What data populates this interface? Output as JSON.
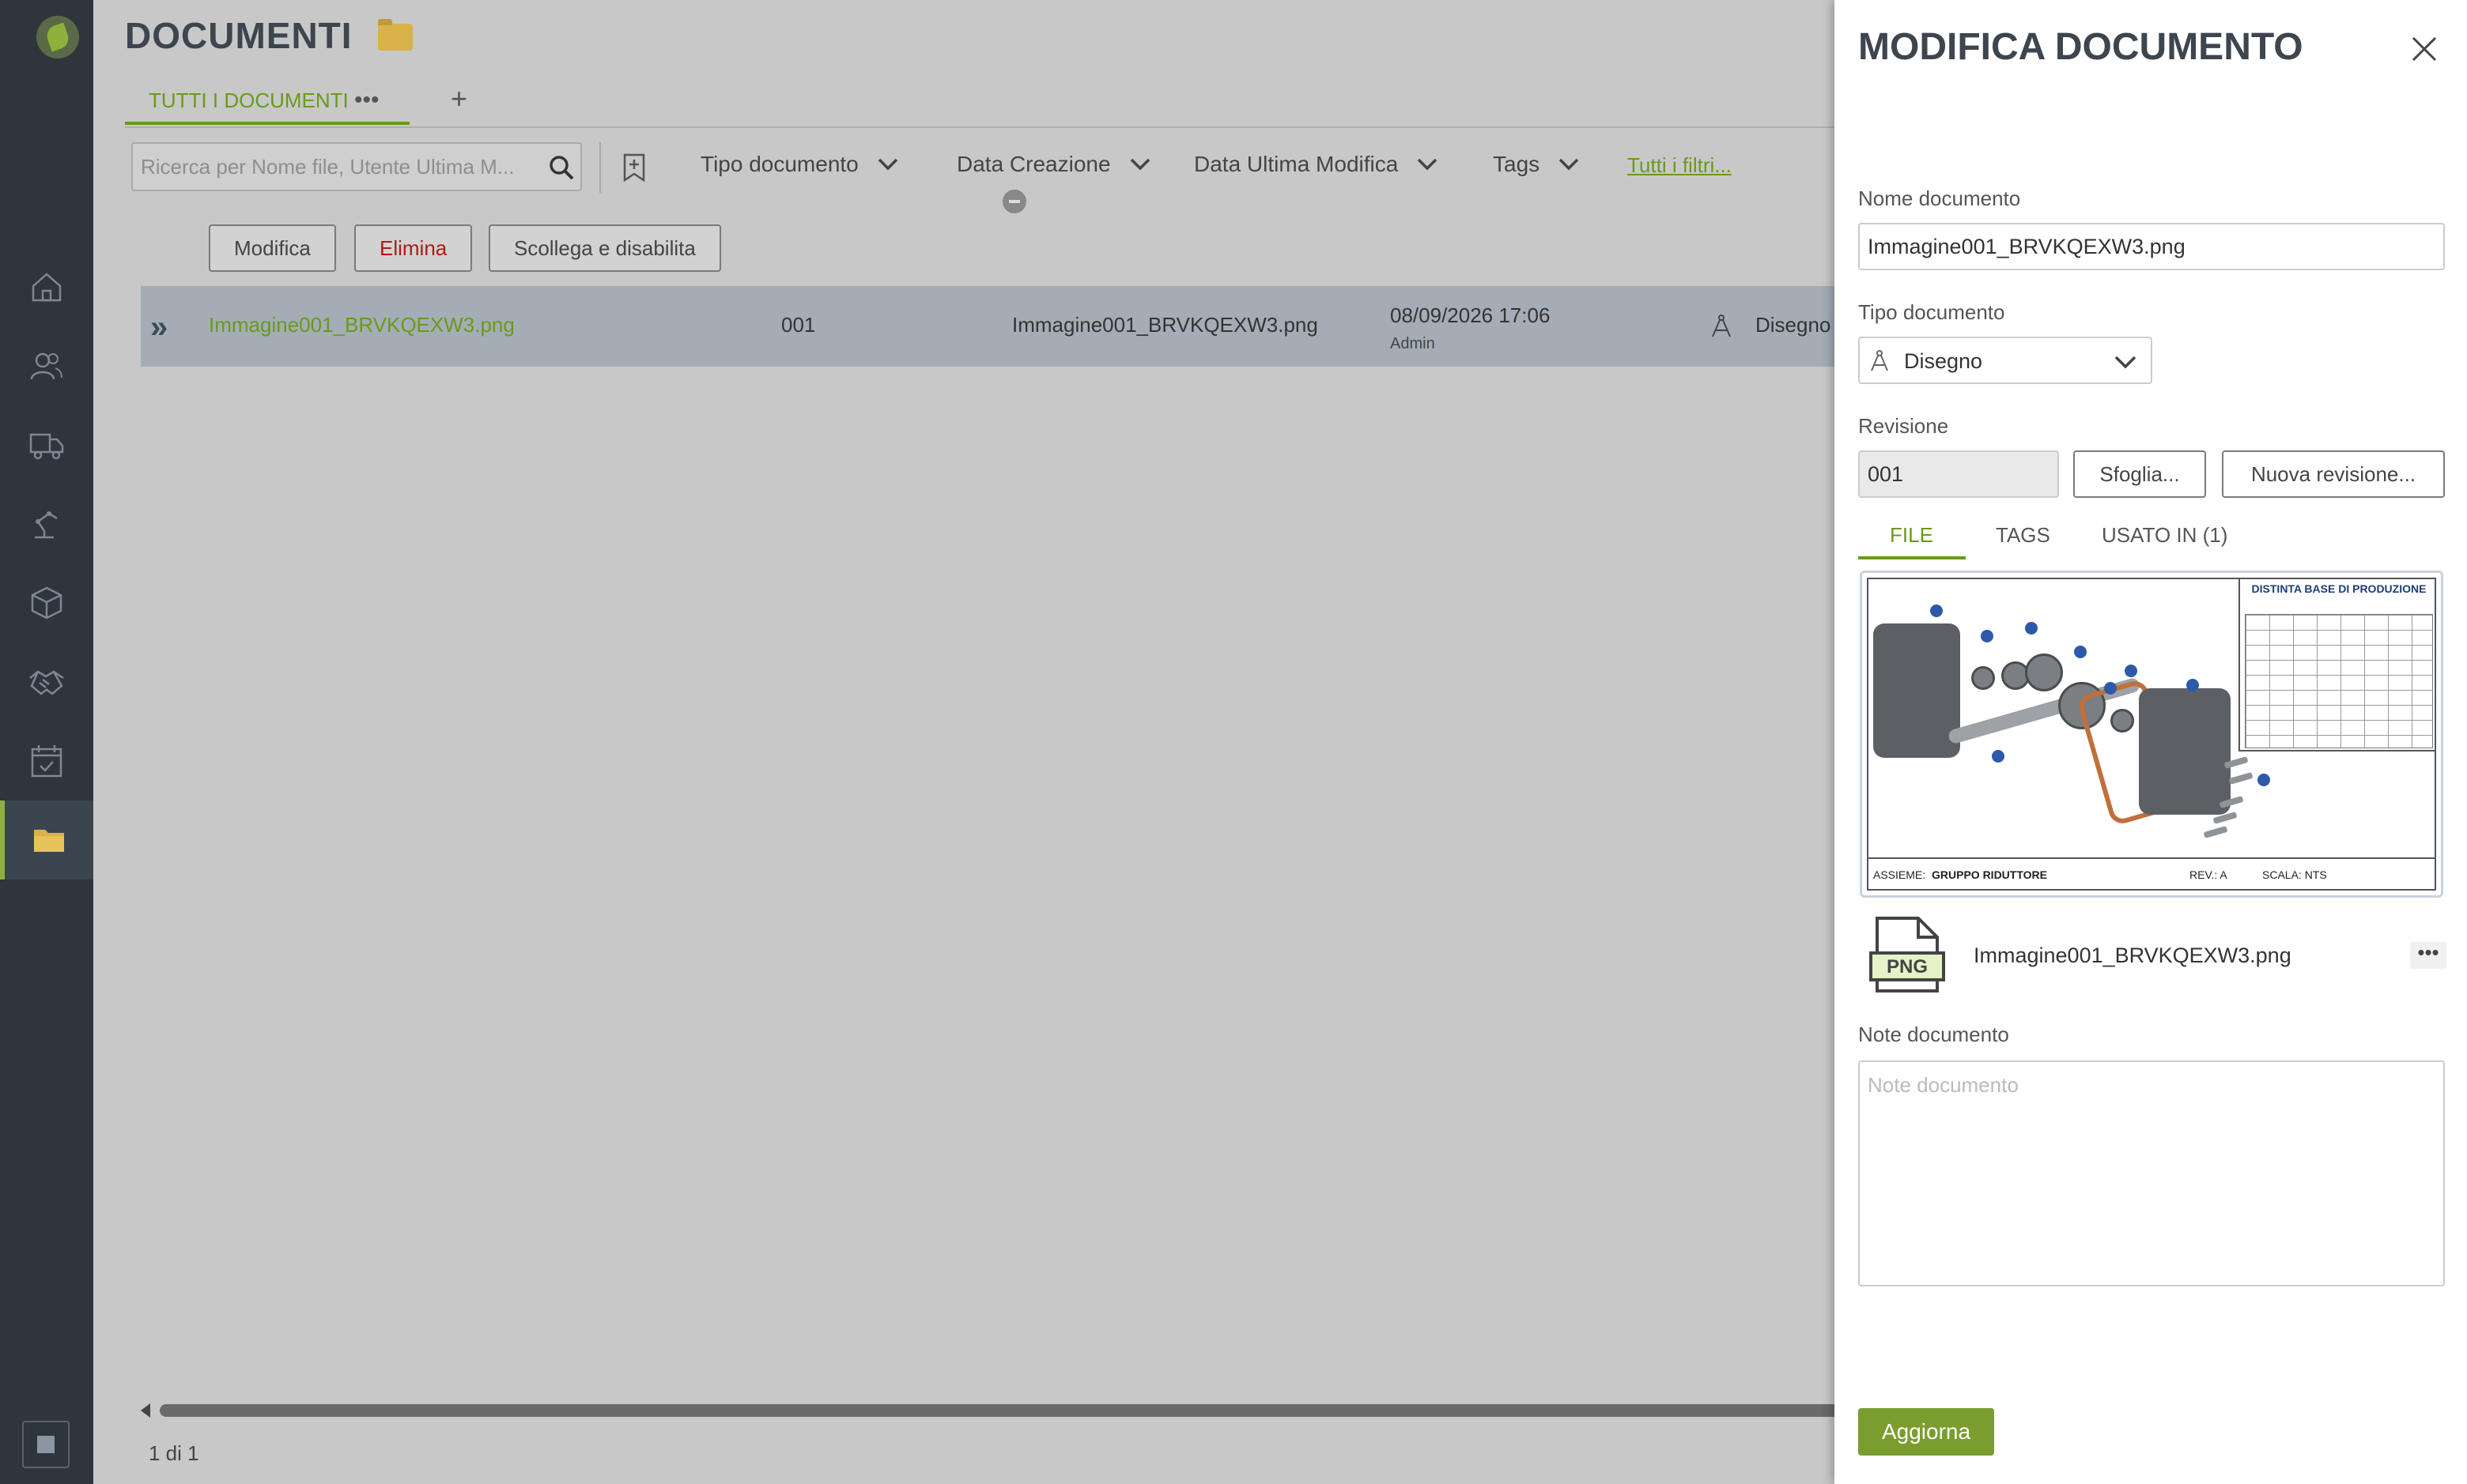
{
  "sidebar": {
    "items": [
      {
        "icon": "home-icon"
      },
      {
        "icon": "contacts-icon"
      },
      {
        "icon": "truck-icon"
      },
      {
        "icon": "robot-arm-icon"
      },
      {
        "icon": "box-icon"
      },
      {
        "icon": "handshake-icon"
      },
      {
        "icon": "calendar-check-icon"
      },
      {
        "icon": "folder-icon",
        "active": true
      }
    ]
  },
  "header": {
    "title": "DOCUMENTI",
    "tab_label": "TUTTI I DOCUMENTI",
    "tab_more": "•••",
    "tab_add": "+"
  },
  "filters": {
    "search_placeholder": "Ricerca per Nome file, Utente Ultima M...",
    "dropdowns": [
      "Tipo documento",
      "Data Creazione",
      "Data Ultima Modifica",
      "Tags"
    ],
    "all_filters_link": "Tutti i filtri..."
  },
  "actions": {
    "edit": "Modifica",
    "delete": "Elimina",
    "unlink": "Scollega e disabilita"
  },
  "table": {
    "rows": [
      {
        "name": "Immagine001_BRVKQEXW3.png",
        "revision": "001",
        "file": "Immagine001_BRVKQEXW3.png",
        "date": "08/09/2026 17:06",
        "user": "Admin",
        "type": "Disegno"
      }
    ]
  },
  "pager": "1 di 1",
  "panel": {
    "title": "MODIFICA DOCUMENTO",
    "name_label": "Nome documento",
    "name_value": "Immagine001_BRVKQEXW3.png",
    "type_label": "Tipo documento",
    "type_value": "Disegno",
    "revision_label": "Revisione",
    "revision_value": "001",
    "browse_button": "Sfoglia...",
    "new_revision_button": "Nuova revisione...",
    "tabs": [
      "FILE",
      "TAGS",
      "USATO IN (1)"
    ],
    "active_tab": "FILE",
    "preview": {
      "bom_title": "DISTINTA BASE DI PRODUZIONE",
      "assembly_label": "ASSIEME:",
      "assembly_name": "GRUPPO RIDUTTORE",
      "rev_label": "REV.: A",
      "scale_label": "SCALA: NTS"
    },
    "file_type": "PNG",
    "file_name": "Immagine001_BRVKQEXW3.png",
    "file_more": "•••",
    "notes_label": "Note documento",
    "notes_placeholder": "Note documento",
    "update_button": "Aggiorna"
  },
  "colors": {
    "accent": "#6a9a1a",
    "sidebar_bg": "#2e353d",
    "danger": "#b01818"
  }
}
